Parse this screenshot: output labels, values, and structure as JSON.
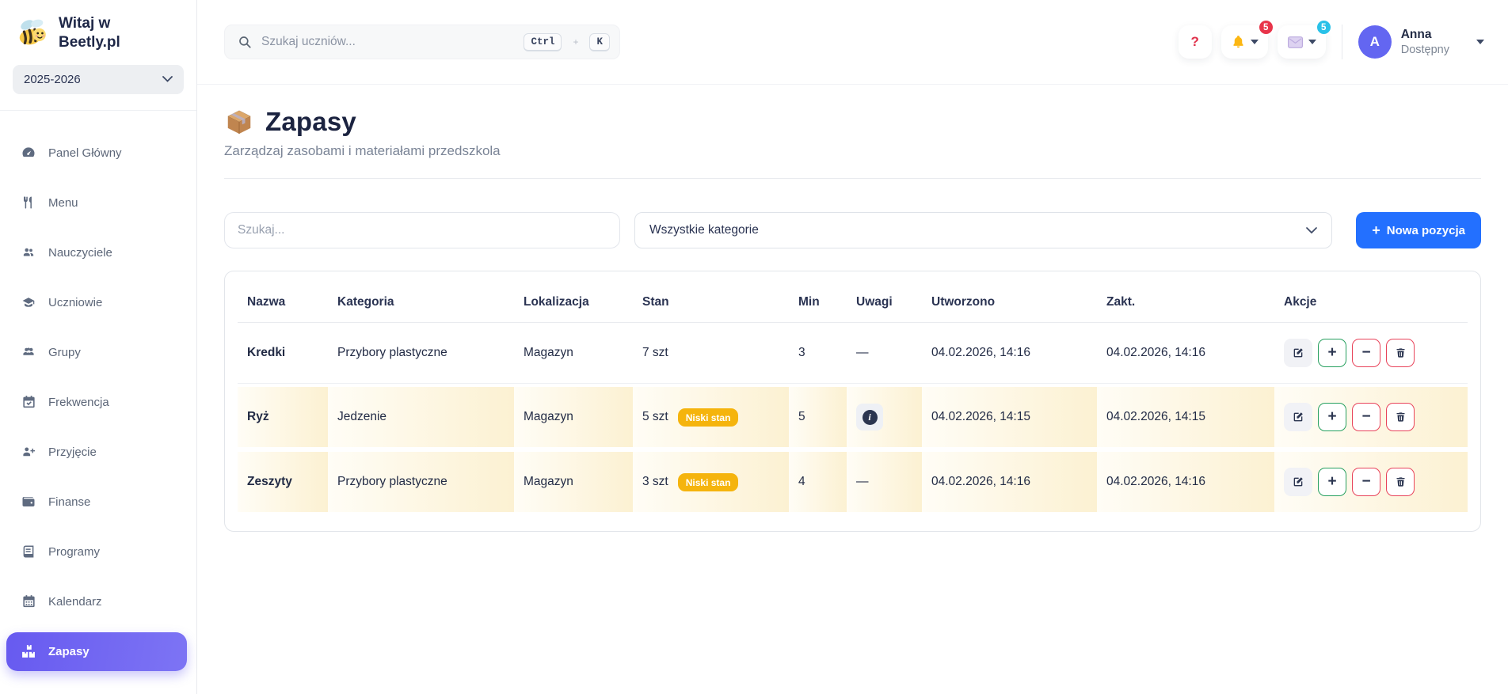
{
  "brand": {
    "welcome_line1": "Witaj w",
    "welcome_line2": "Beetly.pl",
    "year": "2025-2026"
  },
  "sidebar": {
    "items": [
      {
        "label": "Panel Główny"
      },
      {
        "label": "Menu"
      },
      {
        "label": "Nauczyciele"
      },
      {
        "label": "Uczniowie"
      },
      {
        "label": "Grupy"
      },
      {
        "label": "Frekwencja"
      },
      {
        "label": "Przyjęcie"
      },
      {
        "label": "Finanse"
      },
      {
        "label": "Programy"
      },
      {
        "label": "Kalendarz"
      },
      {
        "label": "Zapasy"
      }
    ]
  },
  "header": {
    "search_placeholder": "Szukaj uczniów...",
    "shortcut_key1": "Ctrl",
    "shortcut_plus": "+",
    "shortcut_key2": "K",
    "help_label": "?",
    "notifications_badge": "5",
    "messages_badge": "5",
    "user": {
      "initial": "A",
      "name": "Anna",
      "status": "Dostępny"
    }
  },
  "page": {
    "title": "Zapasy",
    "subtitle": "Zarządzaj zasobami i materiałami przedszkola"
  },
  "filters": {
    "search_placeholder": "Szukaj...",
    "category_selected": "Wszystkie kategorie",
    "new_item_plus": "+",
    "new_item_label": "Nowa pozycja"
  },
  "table": {
    "headers": [
      "Nazwa",
      "Kategoria",
      "Lokalizacja",
      "Stan",
      "Min",
      "Uwagi",
      "Utworzono",
      "Zakt.",
      "Akcje"
    ],
    "low_stock_label": "Niski stan",
    "empty_note": "—",
    "rows": [
      {
        "name": "Kredki",
        "category": "Przybory plastyczne",
        "location": "Magazyn",
        "stock": "7 szt",
        "min": "3",
        "note": "—",
        "created": "04.02.2026, 14:16",
        "updated": "04.02.2026, 14:16"
      },
      {
        "name": "Ryż",
        "category": "Jedzenie",
        "location": "Magazyn",
        "stock": "5 szt",
        "min": "5",
        "note": "",
        "created": "04.02.2026, 14:15",
        "updated": "04.02.2026, 14:15"
      },
      {
        "name": "Zeszyty",
        "category": "Przybory plastyczne",
        "location": "Magazyn",
        "stock": "3 szt",
        "min": "4",
        "note": "—",
        "created": "04.02.2026, 14:16",
        "updated": "04.02.2026, 14:16"
      }
    ]
  },
  "colors": {
    "accent_purple": "#6f63f1",
    "avatar_purple": "#6366f1",
    "primary_blue": "#2370ff",
    "warning_amber": "#f5b40d",
    "danger_red": "#e8344a",
    "info_cyan": "#29c1e8",
    "success_green": "#27a05f",
    "text_navy": "#222b45"
  }
}
